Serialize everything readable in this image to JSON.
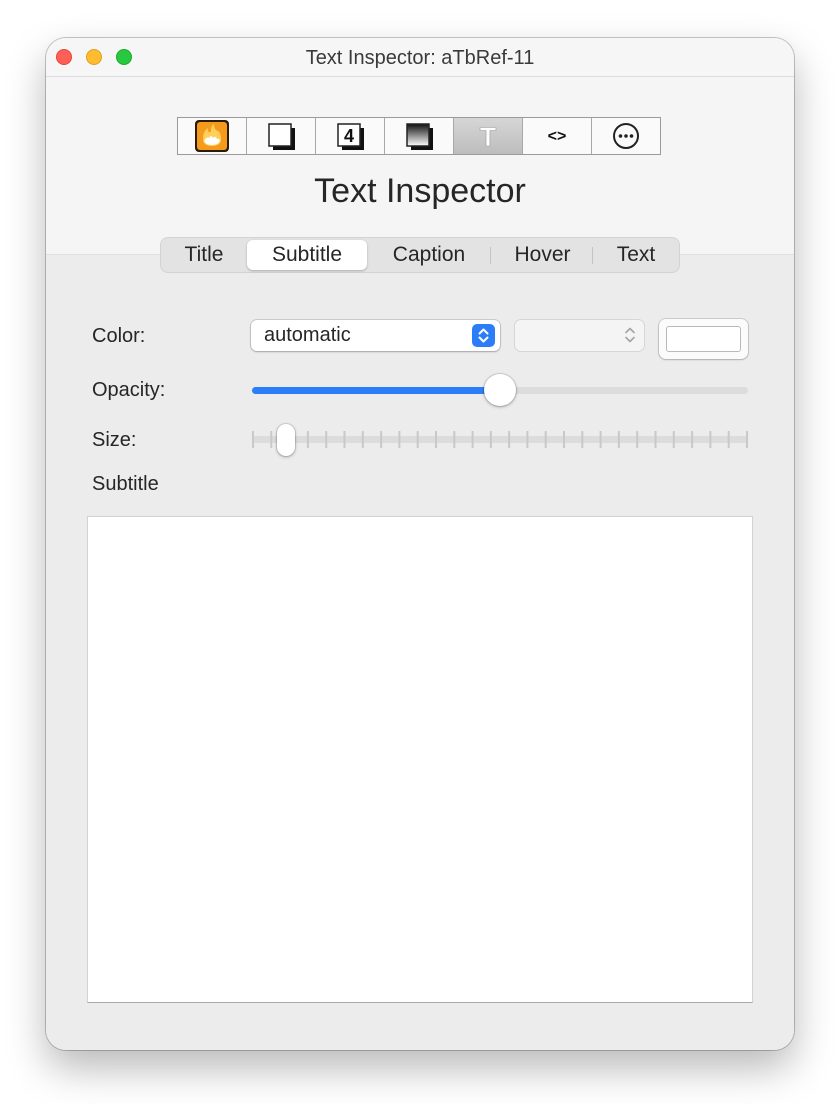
{
  "window": {
    "title": "Text Inspector: aTbRef-11"
  },
  "toolbar": {
    "buttons": [
      {
        "icon": "flame-badge-icon",
        "selected": false
      },
      {
        "icon": "note-shadow-icon",
        "selected": false
      },
      {
        "icon": "number-four-icon",
        "selected": false
      },
      {
        "icon": "gradient-box-icon",
        "selected": false
      },
      {
        "icon": "text-t-icon",
        "selected": true
      },
      {
        "icon": "code-brackets-icon",
        "selected": false
      },
      {
        "icon": "more-ellipsis-icon",
        "selected": false
      }
    ],
    "code_glyph": "<>",
    "number_glyph": "4",
    "text_glyph": "T"
  },
  "inspector": {
    "heading": "Text Inspector"
  },
  "tabs": {
    "items": [
      "Title",
      "Subtitle",
      "Caption",
      "Hover",
      "Text"
    ],
    "selected": "Subtitle"
  },
  "form": {
    "color_label": "Color:",
    "color_value": "automatic",
    "opacity_label": "Opacity:",
    "opacity_fraction": 0.5,
    "size_label": "Size:",
    "size_tick_count": 28,
    "size_step": 2,
    "section_label": "Subtitle"
  },
  "colors": {
    "accent": "#2c7ef8",
    "flame_badge": "#f49a1c",
    "close": "#ff5f57",
    "minimize": "#febc2e",
    "zoom": "#28c840"
  }
}
